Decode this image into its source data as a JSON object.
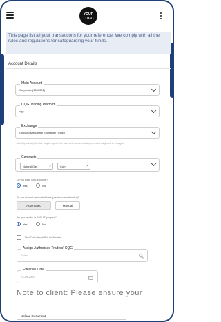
{
  "header": {
    "logo_text": "YOUR LOGO"
  },
  "notice": {
    "text": "This page list all your transactions for your reference. We comply with all the rules and regulations for safeguarding your funds."
  },
  "section": {
    "title": "Account Details"
  },
  "form": {
    "main_account": {
      "label": "Main Account",
      "value": "Corporate (1000001)"
    },
    "trading_platform": {
      "label": "CQG Trading Platform",
      "value": "cqg"
    },
    "exchange": {
      "label": "Exchange",
      "value": "Chicago Mercantile Exchange (CME)"
    },
    "exchange_helper": "Monthly subscription fee may be applied for access to some exchanges and is subjected to changes.",
    "contracts": {
      "label": "Contracts",
      "chips": [
        "Natural Gas",
        "Corn"
      ]
    },
    "q_cme_products": "Do you trade CME products?",
    "q_automated": "Do you conduct automated trading and/or manual trading?",
    "q_cbot": "Are you familiar to CME I/F program?",
    "yes_label": "Yes",
    "no_label": "No",
    "automated_label": "Automated",
    "manual_label": "Manual",
    "checkbox_label": "Non-Professional Self Certification",
    "trader_cqg": {
      "label": "Assign Authorised Traders' CQG",
      "placeholder": "Select"
    },
    "effective_date": {
      "label": "Effective Date",
      "value": "23-09-2020"
    },
    "note": "Note to client: Please ensure your",
    "upload_label": "Upload Document"
  },
  "colors": {
    "frame": "#1f3f78",
    "notice_bg": "#e7ecf5",
    "radio_active": "#1f5fb8"
  }
}
